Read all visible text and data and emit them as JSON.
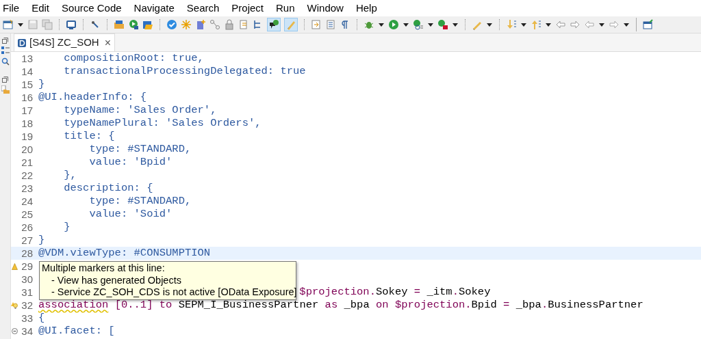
{
  "menu": [
    "File",
    "Edit",
    "Source Code",
    "Navigate",
    "Search",
    "Project",
    "Run",
    "Window",
    "Help"
  ],
  "toolbar_toggles": [
    {
      "pressed": true
    },
    {
      "pressed": true
    }
  ],
  "tab": {
    "label": "[S4S] ZC_SOH",
    "close": "×",
    "selected": true
  },
  "lines": [
    {
      "number": "13",
      "tokens": [
        {
          "t": "    compositionRoot: true,",
          "kind": "anno"
        }
      ]
    },
    {
      "number": "14",
      "tokens": [
        {
          "t": "    transactionalProcessingDelegated: true",
          "kind": "anno"
        }
      ]
    },
    {
      "number": "15",
      "tokens": [
        {
          "t": "}",
          "kind": "anno"
        }
      ]
    },
    {
      "number": "16",
      "tokens": [
        {
          "t": "@UI.headerInfo: {",
          "kind": "anno"
        }
      ]
    },
    {
      "number": "17",
      "tokens": [
        {
          "t": "    typeName: 'Sales Order',",
          "kind": "anno"
        }
      ]
    },
    {
      "number": "18",
      "tokens": [
        {
          "t": "    typeNamePlural: 'Sales Orders',",
          "kind": "anno"
        }
      ]
    },
    {
      "number": "19",
      "tokens": [
        {
          "t": "    title: {",
          "kind": "anno"
        }
      ]
    },
    {
      "number": "20",
      "tokens": [
        {
          "t": "        type: #STANDARD,",
          "kind": "anno"
        }
      ]
    },
    {
      "number": "21",
      "tokens": [
        {
          "t": "        value: 'Bpid'",
          "kind": "anno"
        }
      ]
    },
    {
      "number": "22",
      "tokens": [
        {
          "t": "    },",
          "kind": "anno"
        }
      ]
    },
    {
      "number": "23",
      "tokens": [
        {
          "t": "    description: {",
          "kind": "anno"
        }
      ]
    },
    {
      "number": "24",
      "tokens": [
        {
          "t": "        type: #STANDARD,",
          "kind": "anno"
        }
      ]
    },
    {
      "number": "25",
      "tokens": [
        {
          "t": "        value: 'Soid'",
          "kind": "anno"
        }
      ]
    },
    {
      "number": "26",
      "tokens": [
        {
          "t": "    }",
          "kind": "anno"
        }
      ]
    },
    {
      "number": "27",
      "tokens": [
        {
          "t": "}",
          "kind": "anno"
        }
      ]
    },
    {
      "number": "28",
      "current": true,
      "tokens": [
        {
          "t": "@VDM.viewType: #CONSUMPTION",
          "kind": "anno"
        }
      ]
    },
    {
      "number": "29",
      "kind": "warning"
    },
    {
      "number": "30"
    },
    {
      "number": "31",
      "covered": true,
      "tokens": [
        {
          "t": "$projection.",
          "kind": "kw"
        },
        {
          "t": "Sokey ",
          "kind": "plain"
        },
        {
          "t": "=",
          "kind": "kw"
        },
        {
          "t": " _itm",
          "kind": "plain"
        },
        {
          "t": ".",
          "kind": "kw"
        },
        {
          "t": "Sokey",
          "kind": "plain"
        }
      ]
    },
    {
      "number": "32",
      "kind": "warning-fix",
      "tokens": [
        {
          "t": "association",
          "kind": "kw",
          "warning": true
        },
        {
          "t": " [0..1] to ",
          "kind": "kw"
        },
        {
          "t": "SEPM_I_BusinessPartner ",
          "kind": "plain"
        },
        {
          "t": "as",
          "kind": "kw"
        },
        {
          "t": " _bpa ",
          "kind": "plain"
        },
        {
          "t": "on $projection.",
          "kind": "kw"
        },
        {
          "t": "Bpid ",
          "kind": "plain"
        },
        {
          "t": "=",
          "kind": "kw"
        },
        {
          "t": " _bpa",
          "kind": "plain"
        },
        {
          "t": ".",
          "kind": "kw"
        },
        {
          "t": "BusinessPartner",
          "kind": "plain"
        }
      ]
    },
    {
      "number": "33",
      "tokens": [
        {
          "t": "{",
          "kind": "anno"
        }
      ]
    },
    {
      "number": "34",
      "kind": "fold",
      "tokens": [
        {
          "t": "@UI.facet: [",
          "kind": "anno"
        }
      ]
    }
  ],
  "tooltip": {
    "title": "Multiple markers at this line:",
    "items": [
      "- View has generated Objects",
      "- Service ZC_SOH_CDS is not active [OData Exposure]"
    ]
  }
}
